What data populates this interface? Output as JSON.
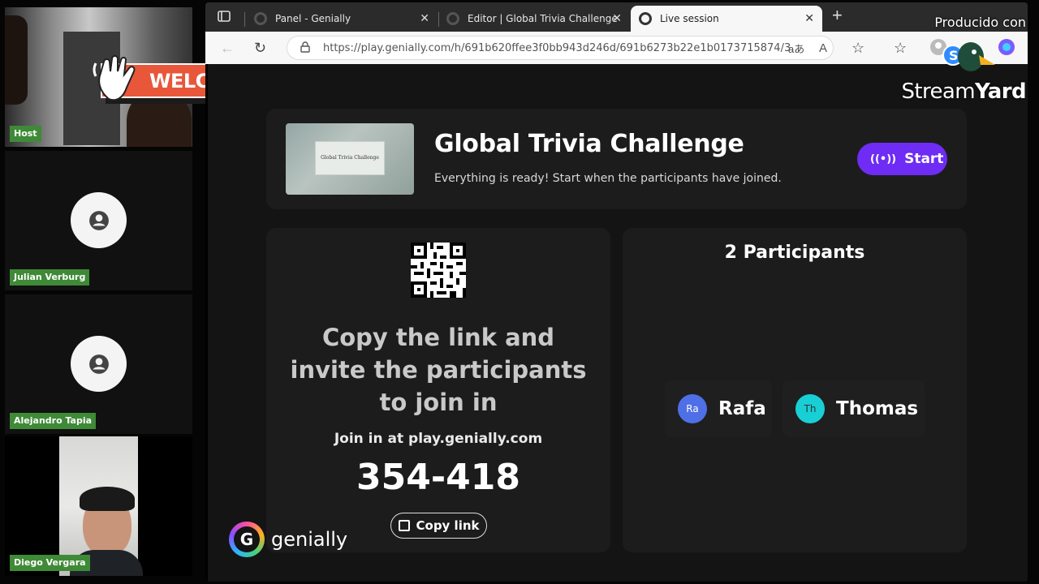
{
  "participants_panel": {
    "tiles": [
      {
        "name": "Host"
      },
      {
        "name": "Julian Verburg"
      },
      {
        "name": "Alejandro Tapia"
      },
      {
        "name": "Diego Vergara"
      }
    ],
    "welcome_banner": "WELCOME!"
  },
  "browser": {
    "tabs": [
      {
        "label": "Panel - Genially",
        "active": false
      },
      {
        "label": "Editor | Global Trivia Challenge",
        "active": false
      },
      {
        "label": "Live session",
        "active": true
      }
    ],
    "url": "https://play.genially.com/h/691b620ffee3f0bb943d246d/691b6273b22e1b0173715874/3..."
  },
  "session": {
    "title": "Global Trivia Challenge",
    "subtitle": "Everything is ready! Start when the participants have joined.",
    "start_label": "Start",
    "thumbnail_text": "Global Trivia Challenge",
    "invite_text": "Copy the link and invite the participants to join in",
    "join_at": "Join in at play.genially.com",
    "code": "354-418",
    "copy_label": "Copy link",
    "participants_heading": "2 Participants",
    "participants": [
      {
        "initials": "Ra",
        "name": "Rafa",
        "color": "#4f6fe6"
      },
      {
        "initials": "Th",
        "name": "Thomas",
        "color": "#19cfd6"
      }
    ],
    "brand": "genially"
  },
  "overlay": {
    "produced_with": "Producido con",
    "stream": "Stream",
    "yard": "Yard"
  },
  "colors": {
    "accent_purple": "#6e2cf5",
    "name_tag_green": "#3f8a37",
    "welcome_orange": "#e8573a"
  }
}
